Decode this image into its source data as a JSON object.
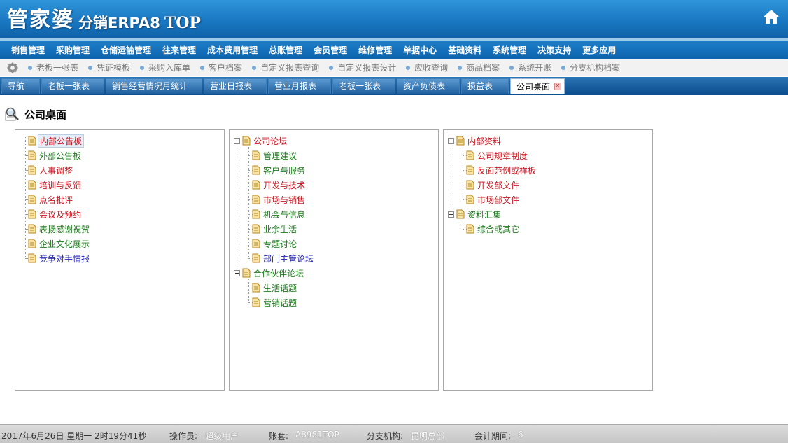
{
  "app": {
    "logo_main": "管家婆",
    "logo_sub": "分销ERPA8",
    "logo_top": "TOP"
  },
  "main_menu": [
    "销售管理",
    "采购管理",
    "仓储运输管理",
    "往来管理",
    "成本费用管理",
    "总账管理",
    "会员管理",
    "维修管理",
    "单据中心",
    "基础资料",
    "系统管理",
    "决策支持",
    "更多应用"
  ],
  "shortcuts": [
    "老板一张表",
    "凭证模板",
    "采购入库单",
    "客户档案",
    "自定义报表查询",
    "自定义报表设计",
    "应收查询",
    "商品档案",
    "系统开账",
    "分支机构档案"
  ],
  "tabs": [
    "导航",
    "老板一张表",
    "销售经营情况月统计",
    "营业日报表",
    "营业月报表",
    "老板一张表",
    "资产负债表",
    "损益表",
    "公司桌面"
  ],
  "tab_close_glyph": "×",
  "page_title": "公司桌面",
  "panel1": {
    "items": [
      {
        "label": "内部公告板",
        "color": "red"
      },
      {
        "label": "外部公告板",
        "color": "green"
      },
      {
        "label": "人事调整",
        "color": "red"
      },
      {
        "label": "培训与反馈",
        "color": "red"
      },
      {
        "label": "点名批评",
        "color": "red"
      },
      {
        "label": "会议及预约",
        "color": "red"
      },
      {
        "label": "表扬感谢祝贺",
        "color": "green"
      },
      {
        "label": "企业文化展示",
        "color": "green"
      },
      {
        "label": "竞争对手情报",
        "color": "blue"
      }
    ]
  },
  "panel2": {
    "group1": "公司论坛",
    "group1_items": [
      "管理建议",
      "客户与服务",
      "开发与技术",
      "市场与销售",
      "机会与信息",
      "业余生活",
      "专题讨论",
      "部门主管论坛"
    ],
    "group2": "合作伙伴论坛",
    "group2_items": [
      "生活话题",
      "营销话题"
    ]
  },
  "panel3": {
    "group1": "内部资料",
    "group1_items": [
      "公司规章制度",
      "反面范例或样板",
      "开发部文件",
      "市场部文件"
    ],
    "group2": "资料汇集",
    "group2_items": [
      "综合或其它"
    ]
  },
  "status": {
    "datetime": "2017年6月26日  星期一  2时19分41秒",
    "operator_label": "操作员:",
    "operator_value": "超级用户",
    "account_label": "账套:",
    "account_value": "A8981TOP",
    "branch_label": "分支机构:",
    "branch_value": "昆明总部",
    "period_label": "会计期间:",
    "period_value": "6"
  }
}
